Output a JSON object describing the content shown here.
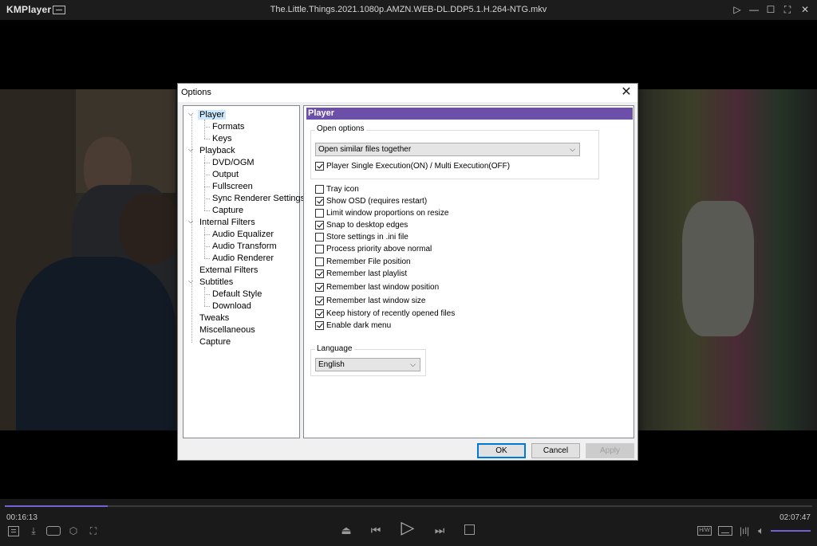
{
  "app": {
    "logo": "KMPlayer",
    "file_title": "The.Little.Things.2021.1080p.AMZN.WEB-DL.DDP5.1.H.264-NTG.mkv"
  },
  "dialog": {
    "title": "Options",
    "tree": [
      {
        "label": "Player",
        "level": 0,
        "expanded": true,
        "selected": true
      },
      {
        "label": "Formats",
        "level": 1
      },
      {
        "label": "Keys",
        "level": 1
      },
      {
        "label": "Playback",
        "level": 0,
        "expanded": true
      },
      {
        "label": "DVD/OGM",
        "level": 1
      },
      {
        "label": "Output",
        "level": 1
      },
      {
        "label": "Fullscreen",
        "level": 1
      },
      {
        "label": "Sync Renderer Settings",
        "level": 1
      },
      {
        "label": "Capture",
        "level": 1
      },
      {
        "label": "Internal Filters",
        "level": 0,
        "expanded": true
      },
      {
        "label": "Audio Equalizer",
        "level": 1
      },
      {
        "label": "Audio Transform",
        "level": 1
      },
      {
        "label": "Audio Renderer",
        "level": 1
      },
      {
        "label": "External Filters",
        "level": 0
      },
      {
        "label": "Subtitles",
        "level": 0,
        "expanded": true
      },
      {
        "label": "Default Style",
        "level": 1
      },
      {
        "label": "Download",
        "level": 1
      },
      {
        "label": "Tweaks",
        "level": 0
      },
      {
        "label": "Miscellaneous",
        "level": 0
      },
      {
        "label": "Capture",
        "level": 0
      }
    ],
    "panel": {
      "header": "Player",
      "open_options": {
        "label": "Open options",
        "combo_value": "Open similar files together",
        "single_exec": {
          "label": "Player Single Execution(ON) / Multi Execution(OFF)",
          "checked": true
        }
      },
      "checkboxes": [
        {
          "label": "Tray icon",
          "checked": false
        },
        {
          "label": "Show OSD (requires restart)",
          "checked": true
        },
        {
          "label": "Limit window proportions on resize",
          "checked": false
        },
        {
          "label": "Snap to desktop edges",
          "checked": true
        },
        {
          "label": "Store settings in .ini file",
          "checked": false
        },
        {
          "label": "Process priority above normal",
          "checked": false
        },
        {
          "label": "Remember File position",
          "checked": false
        },
        {
          "label": "Remember last playlist",
          "checked": true
        },
        {
          "label": "Remember last window position",
          "checked": true
        },
        {
          "label": "Remember last window size",
          "checked": true
        },
        {
          "label": "Keep history of recently opened files",
          "checked": true
        },
        {
          "label": "Enable dark menu",
          "checked": true
        }
      ],
      "language": {
        "label": "Language",
        "value": "English"
      }
    },
    "buttons": {
      "ok": "OK",
      "cancel": "Cancel",
      "apply": "Apply"
    }
  },
  "controls": {
    "elapsed": "00:16:13",
    "total": "02:07:47",
    "progress": 0.127,
    "volume": 1.0,
    "left_icons": [
      "playlist-icon",
      "download-icon",
      "vr-icon",
      "3d-cube-icon",
      "capture-icon"
    ],
    "center_icons": [
      "eject-icon",
      "previous-icon",
      "play-icon",
      "next-icon",
      "stop-icon"
    ],
    "right_icons": [
      "hw-icon",
      "subtitle-icon",
      "audio-wave-icon",
      "volume-icon"
    ],
    "right_labels": {
      "hw": "H/W"
    }
  },
  "colors": {
    "accent": "#7561d6",
    "panel_header": "#6b4fa8"
  }
}
